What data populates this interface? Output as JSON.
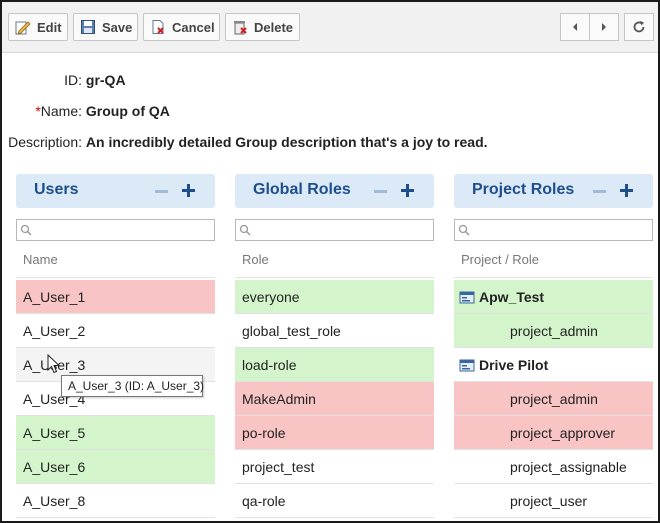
{
  "toolbar": {
    "edit_label": "Edit",
    "save_label": "Save",
    "cancel_label": "Cancel",
    "delete_label": "Delete"
  },
  "form": {
    "id_label": "ID:",
    "id_value": "gr-QA",
    "name_required": "*",
    "name_label": "Name:",
    "name_value": "Group of QA",
    "description_label": "Description:",
    "description_value": "An incredibly detailed Group description that's a joy to read."
  },
  "users_panel": {
    "title": "Users",
    "search_placeholder": "",
    "column": "Name",
    "rows": [
      {
        "label": "A_User_1",
        "status": "red"
      },
      {
        "label": "A_User_2",
        "status": "none"
      },
      {
        "label": "A_User_3",
        "status": "hover"
      },
      {
        "label": "A_User_4",
        "status": "none"
      },
      {
        "label": "A_User_5",
        "status": "green"
      },
      {
        "label": "A_User_6",
        "status": "green"
      },
      {
        "label": "A_User_8",
        "status": "none"
      }
    ],
    "tooltip": "A_User_3 (ID: A_User_3)"
  },
  "global_roles_panel": {
    "title": "Global Roles",
    "search_placeholder": "",
    "column": "Role",
    "rows": [
      {
        "label": "everyone",
        "status": "green"
      },
      {
        "label": "global_test_role",
        "status": "none"
      },
      {
        "label": "load-role",
        "status": "green"
      },
      {
        "label": "MakeAdmin",
        "status": "red"
      },
      {
        "label": "po-role",
        "status": "red"
      },
      {
        "label": "project_test",
        "status": "none"
      },
      {
        "label": "qa-role",
        "status": "none"
      }
    ]
  },
  "project_roles_panel": {
    "title": "Project Roles",
    "search_placeholder": "",
    "column": "Project / Role",
    "rows": [
      {
        "label": "Apw_Test",
        "status": "green",
        "kind": "project"
      },
      {
        "label": "project_admin",
        "status": "green",
        "kind": "role"
      },
      {
        "label": "Drive Pilot",
        "status": "none",
        "kind": "project"
      },
      {
        "label": "project_admin",
        "status": "red",
        "kind": "role"
      },
      {
        "label": "project_approver",
        "status": "red",
        "kind": "role"
      },
      {
        "label": "project_assignable",
        "status": "none",
        "kind": "role"
      },
      {
        "label": "project_user",
        "status": "none",
        "kind": "role"
      }
    ]
  },
  "icons": [
    "edit-icon",
    "save-icon",
    "cancel-icon",
    "delete-icon",
    "chevron-left-icon",
    "chevron-right-icon",
    "refresh-icon",
    "search-icon",
    "project-icon",
    "plus-icon",
    "minus-icon",
    "mouse-cursor-icon"
  ],
  "colors": {
    "accent": "#1f4e8c",
    "panel_header_bg": "#dceaf7",
    "added_row": "#d4f5cc",
    "removed_row": "#f9c4c4"
  }
}
